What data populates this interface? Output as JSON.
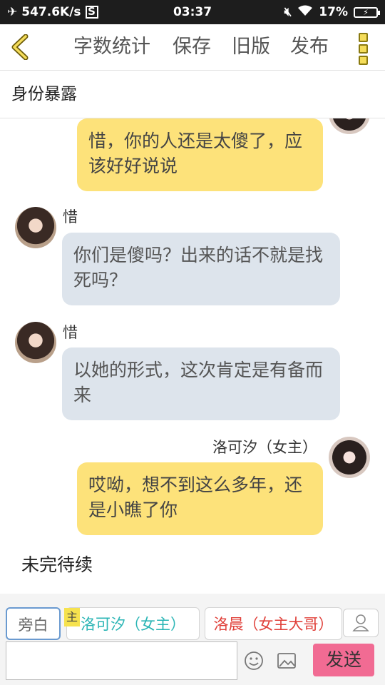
{
  "status_bar": {
    "network_speed": "547.6K/s",
    "time": "03:37",
    "battery": "17%",
    "icons": [
      "airplane-icon",
      "screenshot-icon",
      "mute-icon",
      "wifi-icon",
      "battery-icon"
    ]
  },
  "toolbar": {
    "word_count": "字数统计",
    "save": "保存",
    "old_version": "旧版",
    "publish": "发布"
  },
  "chapter_title": "身份暴露",
  "messages": [
    {
      "side": "right",
      "text": "惜，你的人还是太傻了，应该好好说说"
    },
    {
      "side": "left",
      "sender": "惜",
      "text": "你们是傻吗？出来的话不就是找死吗？"
    },
    {
      "side": "left",
      "sender": "惜",
      "text": "以她的形式，这次肯定是有备而来"
    },
    {
      "side": "right",
      "sender": "洛可汐（女主）",
      "text": "哎呦，想不到这么多年，还是小瞧了你"
    }
  ],
  "pending_text": "未完待续",
  "roles": {
    "narration": "旁白",
    "main_badge": "主",
    "role1": "洛可汐（女主）",
    "role2": "洛晨（女主大哥）"
  },
  "send_label": "发送",
  "colors": {
    "my_bubble": "#fde27a",
    "other_bubble": "#dde4ec",
    "send_button": "#f16b93",
    "role1_text": "#2ab5b5",
    "role2_text": "#e0403a"
  }
}
